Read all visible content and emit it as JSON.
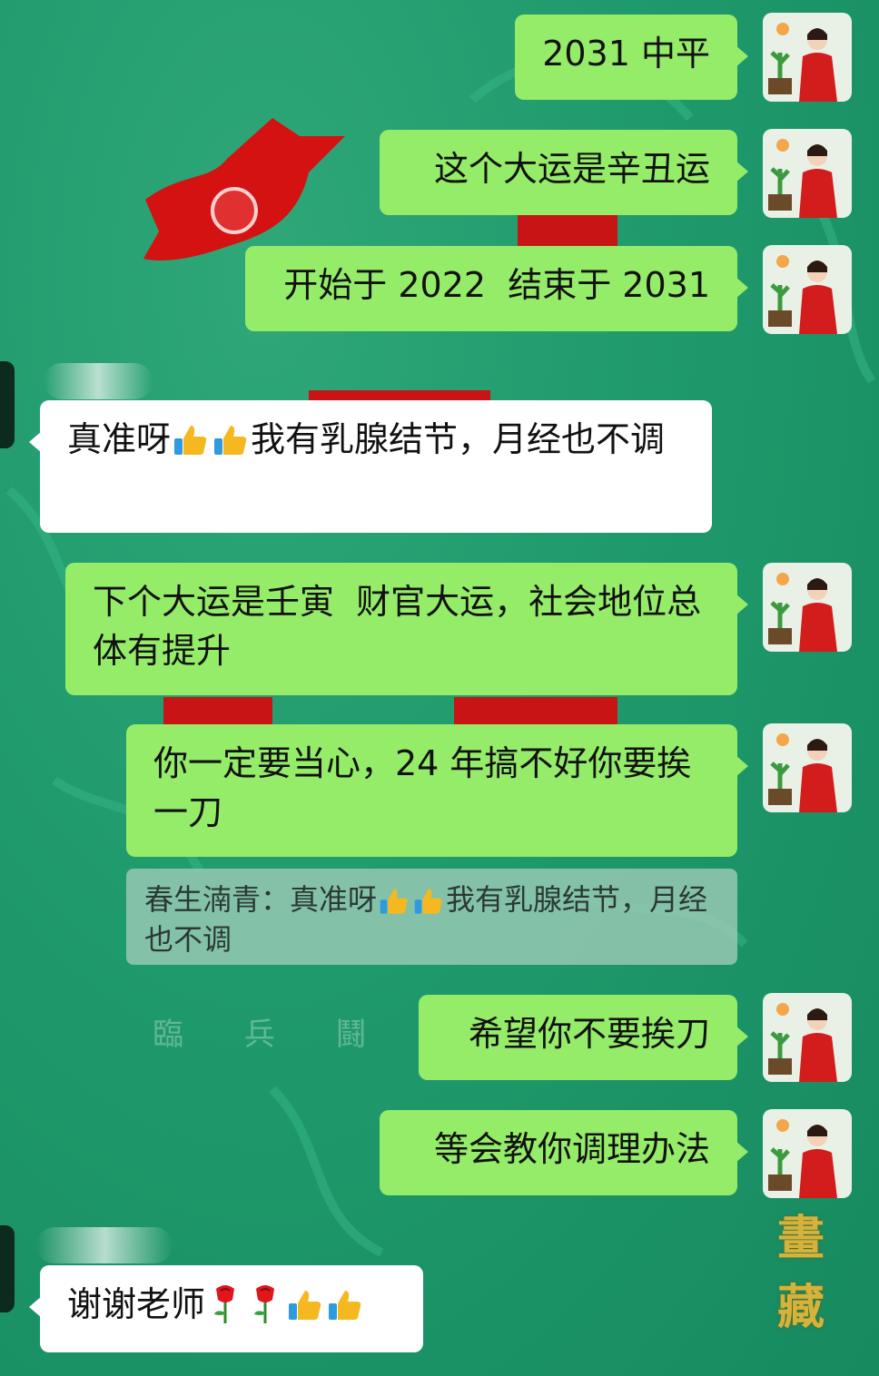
{
  "messages": [
    {
      "text": "2031 中平"
    },
    {
      "text": "这个大运是辛丑运"
    },
    {
      "text": "开始于 2022  结束于 2031"
    },
    {
      "text_a": "真准呀",
      "text_b": "我有乳腺结节，月经也不调"
    },
    {
      "text": "下个大运是壬寅  财官大运，社会地位总体有提升"
    },
    {
      "text": "你一定要当心，24 年搞不好你要挨一刀"
    },
    {
      "sender": "春生湳青：",
      "text_a": "真准呀",
      "text_b": "我有乳腺结节，月经也不调"
    },
    {
      "text": "希望你不要挨刀"
    },
    {
      "text": "等会教你调理办法"
    },
    {
      "text": "谢谢老师"
    }
  ],
  "background": {
    "engraving": "臨 兵 鬪 者 皆",
    "seal_chars": [
      "畫",
      "藏"
    ]
  },
  "colors": {
    "background": "#1f9a6c",
    "outgoing_bubble": "#95ec69",
    "incoming_bubble": "#ffffff",
    "quote_bubble": "#96c8b4"
  },
  "icons": [
    "thumbs-up-icon",
    "rose-icon",
    "avatar"
  ]
}
